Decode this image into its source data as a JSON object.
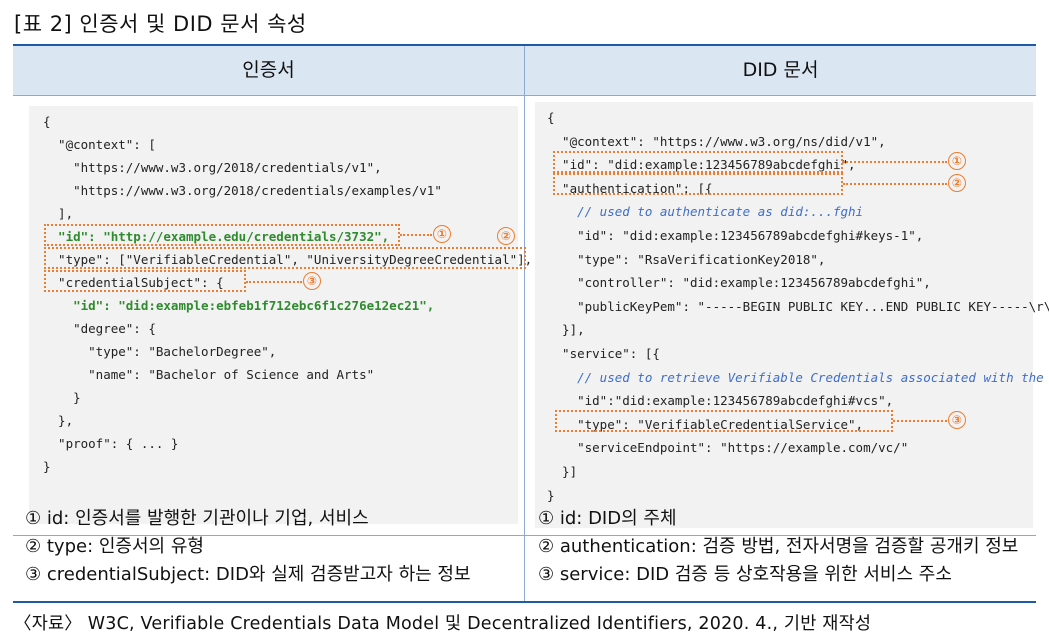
{
  "title": "[표 2] 인증서 및 DID 문서 속성",
  "header": {
    "left": "인증서",
    "right": "DID 문서"
  },
  "left_code": [
    {
      "text": "{"
    },
    {
      "text": "  \"@context\": ["
    },
    {
      "text": "    \"https://www.w3.org/2018/credentials/v1\","
    },
    {
      "text": "    \"https://www.w3.org/2018/credentials/examples/v1\""
    },
    {
      "text": "  ],"
    },
    {
      "text": "  \"id\": \"http://example.edu/credentials/3732\",",
      "style": "g"
    },
    {
      "text": "  \"type\": [\"VerifiableCredential\", \"UniversityDegreeCredential\"],"
    },
    {
      "text": "  \"credentialSubject\": {"
    },
    {
      "text": "    \"id\": \"did:example:ebfeb1f712ebc6f1c276e12ec21\",",
      "style": "g"
    },
    {
      "text": "    \"degree\": {"
    },
    {
      "text": "      \"type\": \"BachelorDegree\","
    },
    {
      "text": "      \"name\": \"Bachelor of Science and Arts\""
    },
    {
      "text": "    }"
    },
    {
      "text": "  },"
    },
    {
      "text": "  \"proof\": { ... }"
    },
    {
      "text": "}"
    }
  ],
  "right_code": [
    {
      "text": "{"
    },
    {
      "text": "  \"@context\": \"https://www.w3.org/ns/did/v1\","
    },
    {
      "text": "  \"id\": \"did:example:123456789abcdefghi\","
    },
    {
      "text": "  \"authentication\": [{"
    },
    {
      "text": "    // used to authenticate as did:...fghi",
      "style": "c"
    },
    {
      "text": "    \"id\": \"did:example:123456789abcdefghi#keys-1\","
    },
    {
      "text": "    \"type\": \"RsaVerificationKey2018\","
    },
    {
      "text": "    \"controller\": \"did:example:123456789abcdefghi\","
    },
    {
      "text": "    \"publicKeyPem\": \"-----BEGIN PUBLIC KEY...END PUBLIC KEY-----\\r\\n\""
    },
    {
      "text": "  }],"
    },
    {
      "text": "  \"service\": [{"
    },
    {
      "text": "    // used to retrieve Verifiable Credentials associated with the DID",
      "style": "c"
    },
    {
      "text": "    \"id\":\"did:example:123456789abcdefghi#vcs\","
    },
    {
      "text": "    \"type\": \"VerifiableCredentialService\","
    },
    {
      "text": "    \"serviceEndpoint\": \"https://example.com/vc/\""
    },
    {
      "text": "  }]"
    },
    {
      "text": "}"
    }
  ],
  "markers": {
    "m1": "①",
    "m2": "②",
    "m3": "③"
  },
  "left_desc": [
    "① id: 인증서를 발행한 기관이나 기업, 서비스",
    "② type: 인증서의 유형",
    "③ credentialSubject: DID와 실제 검증받고자 하는 정보"
  ],
  "right_desc": [
    "① id: DID의 주체",
    "② authentication: 검증 방법, 전자서명을 검증할 공개키 정보",
    "③ service: DID 검증 등 상호작용을 위한 서비스 주소"
  ],
  "source": "〈자료〉 W3C, Verifiable Credentials Data Model 및 Decentralized Identifiers, 2020. 4., 기반 재작성",
  "colors": {
    "accent": "#ed7d31",
    "rule": "#1f5aa6",
    "header_bg": "#dbe6f3",
    "code_bg": "#f2f2f2",
    "code_green": "#2e8b2e",
    "code_comment": "#3f6ec6"
  }
}
